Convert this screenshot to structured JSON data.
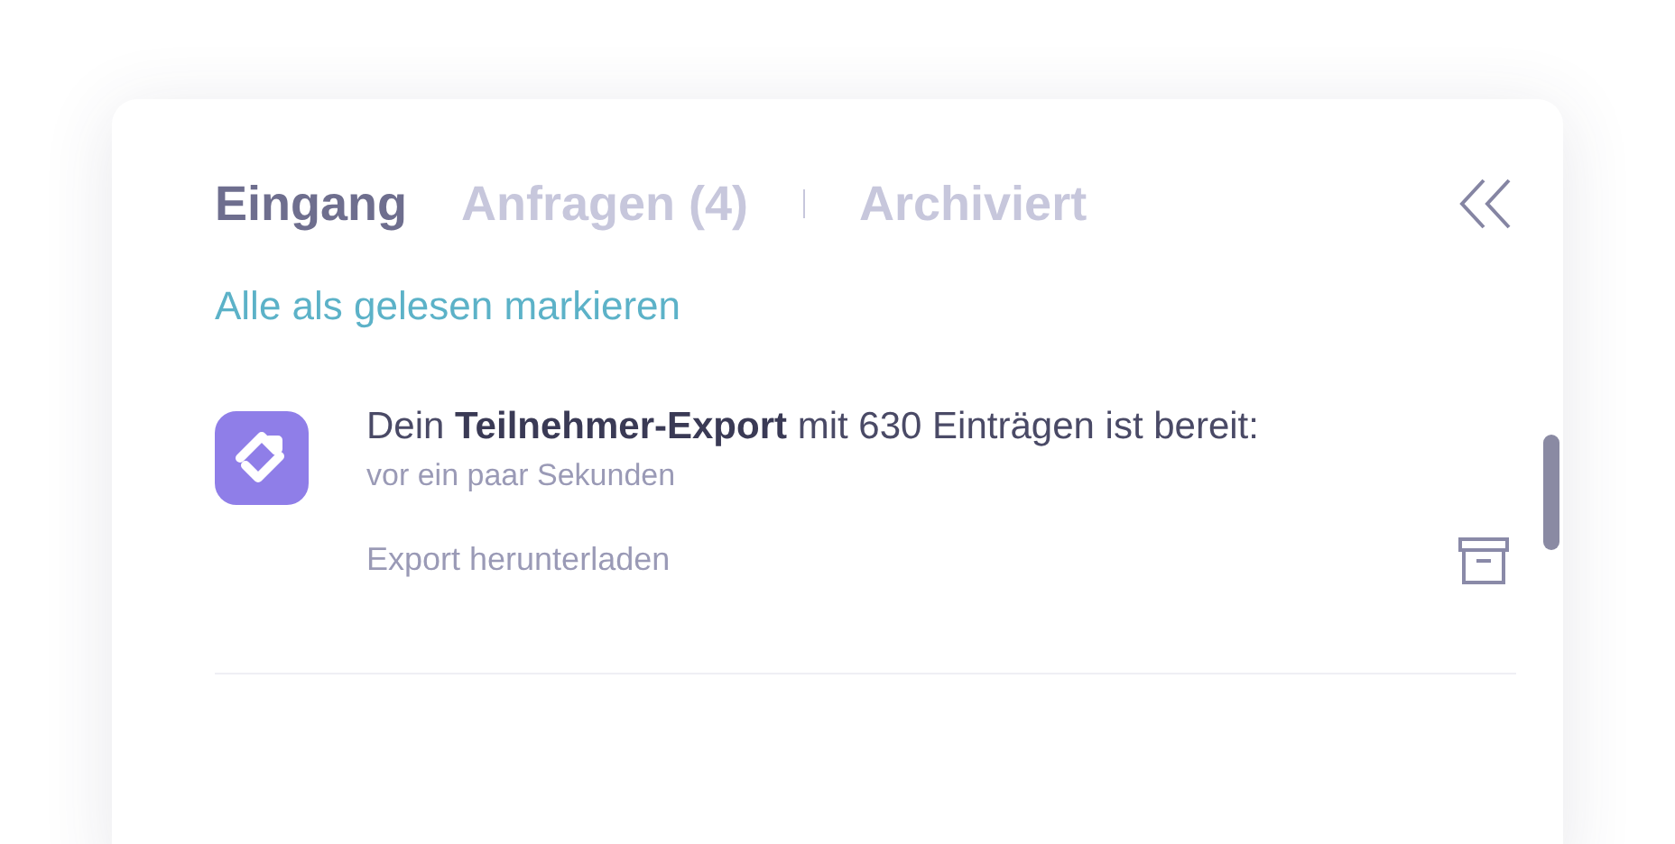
{
  "tabs": [
    {
      "label": "Eingang",
      "selected": true
    },
    {
      "label": "Anfragen (4)",
      "selected": false
    },
    {
      "label": "Archiviert",
      "selected": false
    }
  ],
  "mark_all_read": "Alle als gelesen markieren",
  "notifications": [
    {
      "message": "Dein **Teilnehmer-Export** mit 630 Einträgen ist bereit:",
      "time": "vor ein paar Sekunden",
      "action": "Export herunterladen"
    }
  ]
}
